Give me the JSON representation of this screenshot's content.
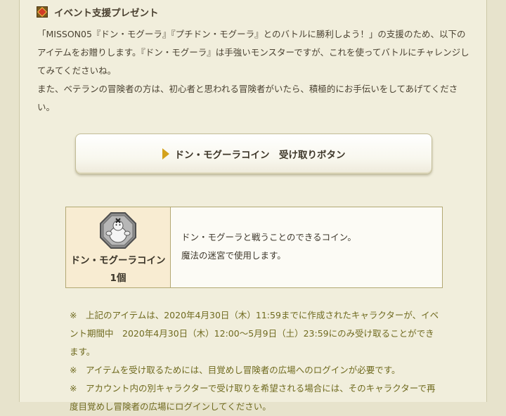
{
  "section": {
    "icon": "present-diamond-icon",
    "title": "イベント支援プレゼント"
  },
  "intro": {
    "paragraph1": "「MISSON05『ドン・モグーラ』『プチドン・モグーラ』とのバトルに勝利しよう！」の支援のため、以下のアイテムをお贈りします。『ドン・モグーラ』は手強いモンスターですが、これを使ってバトルにチャレンジしてみてくださいね。",
    "paragraph2": "また、ベテランの冒険者の方は、初心者と思われる冒険者がいたら、積極的にお手伝いをしてあげてください。"
  },
  "claim_button": {
    "icon": "play-triangle-icon",
    "label": "ドン・モグーラコイン　受け取りボタン"
  },
  "item": {
    "icon": "don-mogura-coin-icon",
    "name": "ドン・モグーラコイン1個",
    "description_line1": "ドン・モグーラと戦うことのできるコイン。",
    "description_line2": "魔法の迷宮で使用します。"
  },
  "notes": [
    "※　上記のアイテムは、2020年4月30日（木）11:59までに作成されたキャラクターが、イベント期間中　2020年4月30日（木）12:00～5月9日（土）23:59にのみ受け取ることができます。",
    "※　アイテムを受け取るためには、目覚めし冒険者の広場へのログインが必要です。",
    "※　アカウント内の別キャラクターで受け取りを希望される場合には、そのキャラクターで再度目覚めし冒険者の広場にログインしてください。"
  ],
  "colors": {
    "page_background": "#e7e3cc",
    "panel_background": "#f1eedc",
    "note_text": "#6f6a1f",
    "item_cell": "#f8ecd2",
    "button_arrow": "#d4a21b"
  }
}
